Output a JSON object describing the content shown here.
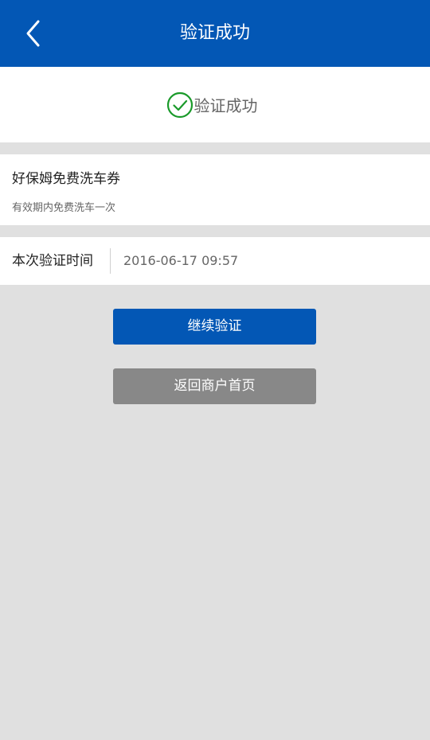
{
  "header": {
    "title": "验证成功",
    "back_icon": "chevron-left-icon",
    "bg_color": "#0357b5"
  },
  "status": {
    "icon": "check-circle-icon",
    "icon_color": "#1a9a2a",
    "text": "验证成功"
  },
  "coupon": {
    "name": "好保姆免费洗车券",
    "description": "有效期内免费洗车一次"
  },
  "verification": {
    "time_label": "本次验证时间",
    "time_value": "2016-06-17 09:57"
  },
  "actions": {
    "continue_label": "继续验证",
    "continue_color": "#0357b5",
    "home_label": "返回商户首页",
    "home_color": "#888888"
  }
}
